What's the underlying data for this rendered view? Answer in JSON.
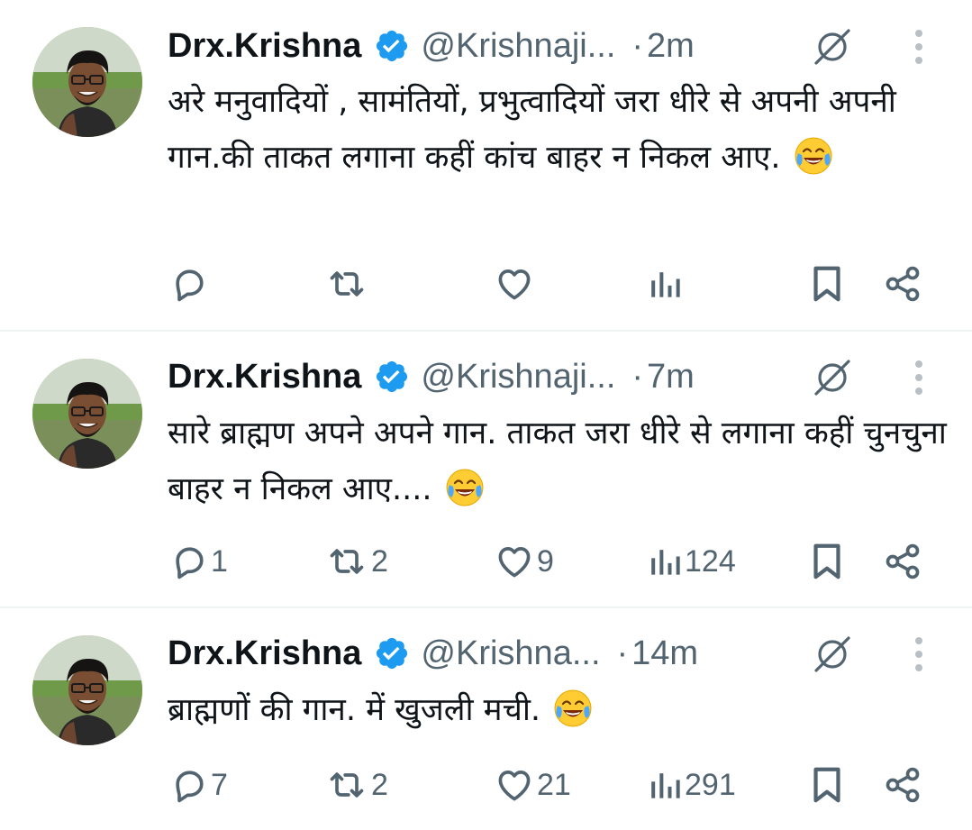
{
  "colors": {
    "text": "#0f1419",
    "muted": "#536471",
    "verified": "#1d9bf0",
    "divider": "#eff3f4"
  },
  "tweets": [
    {
      "name": "Drx.Krishna",
      "handle": "@Krishnaji...",
      "separator": "·",
      "time": "2m",
      "text": "अरे मनुवादियों , सामंतियों, प्रभुत्वादियों जरा धीरे से अपनी अपनी गान.की ताकत लगाना कहीं कांच बाहर न निकल आए.",
      "emoji": "face-with-tears-of-joy",
      "replies": "",
      "reposts": "",
      "likes": "",
      "views": ""
    },
    {
      "name": "Drx.Krishna",
      "handle": "@Krishnaji...",
      "separator": "·",
      "time": "7m",
      "text": "सारे ब्राह्मण अपने अपने गान. ताकत जरा धीरे से लगाना कहीं चुनचुना बाहर न निकल आए....",
      "emoji": "face-with-tears-of-joy",
      "replies": "1",
      "reposts": "2",
      "likes": "9",
      "views": "124"
    },
    {
      "name": "Drx.Krishna",
      "handle": "@Krishna...",
      "separator": "·",
      "time": "14m",
      "text": "ब्राह्मणों की गान. में खुजली मची.",
      "emoji": "face-with-tears-of-joy",
      "replies": "7",
      "reposts": "2",
      "likes": "21",
      "views": "291"
    }
  ],
  "icons": {
    "avatar": "profile-photo",
    "verified": "verified-badge-icon",
    "grok": "grok-icon",
    "more": "more-vertical-icon",
    "reply": "reply-icon",
    "repost": "repost-icon",
    "like": "heart-icon",
    "views": "views-icon",
    "bookmark": "bookmark-icon",
    "share": "share-icon"
  }
}
